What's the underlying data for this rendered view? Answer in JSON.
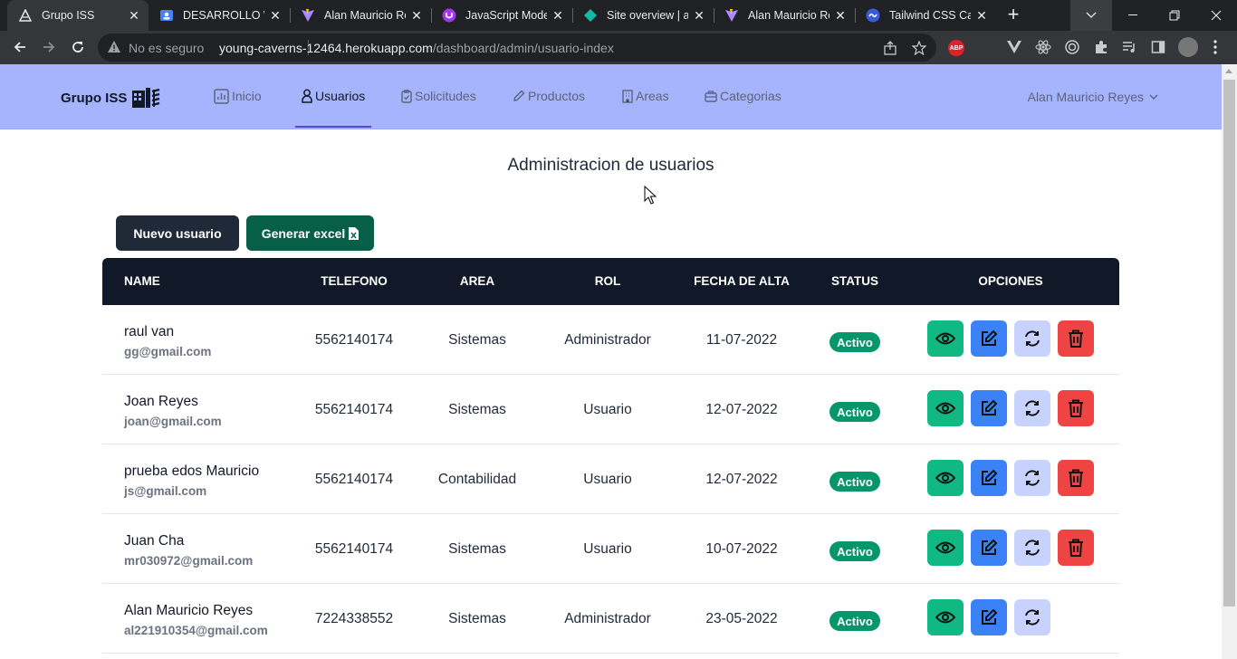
{
  "browser": {
    "tabs": [
      {
        "title": "Grupo ISS",
        "favicon": "triangle-logo-icon",
        "active": true
      },
      {
        "title": "DESARROLLO WE",
        "favicon": "google-sites-icon",
        "active": false
      },
      {
        "title": "Alan Mauricio Re",
        "favicon": "vite-icon",
        "active": false
      },
      {
        "title": "JavaScript Moder",
        "favicon": "udemy-icon",
        "active": false
      },
      {
        "title": "Site overview | al",
        "favicon": "netlify-icon",
        "active": false
      },
      {
        "title": "Alan Mauricio Re",
        "favicon": "vite-icon",
        "active": false
      },
      {
        "title": "Tailwind CSS Card",
        "favicon": "tailwind-icon",
        "active": false
      }
    ],
    "omnibox": {
      "security": "No es seguro",
      "host": "young-caverns-12464.herokuapp.com",
      "path": "/dashboard/admin/usuario-index"
    },
    "extensions": {
      "abp": "ABP"
    }
  },
  "nav": {
    "brand": "Grupo ISS",
    "items": [
      {
        "label": "Inicio",
        "icon": "chart-icon"
      },
      {
        "label": "Usuarios",
        "icon": "user-icon"
      },
      {
        "label": "Solicitudes",
        "icon": "clipboard-icon"
      },
      {
        "label": "Productos",
        "icon": "pencil-icon"
      },
      {
        "label": "Areas",
        "icon": "building-icon"
      },
      {
        "label": "Categorias",
        "icon": "briefcase-icon"
      }
    ],
    "user": "Alan Mauricio Reyes"
  },
  "page": {
    "title": "Administracion de usuarios",
    "new_user_button": "Nuevo usuario",
    "excel_button": "Generar excel"
  },
  "table": {
    "headers": [
      "NAME",
      "TELEFONO",
      "AREA",
      "ROL",
      "FECHA DE ALTA",
      "STATUS",
      "OPCIONES"
    ],
    "rows": [
      {
        "name": "raul van",
        "email": "gg@gmail.com",
        "phone": "5562140174",
        "area": "Sistemas",
        "role": "Administrador",
        "date": "11-07-2022",
        "status": "Activo",
        "deletable": true
      },
      {
        "name": "Joan Reyes",
        "email": "joan@gmail.com",
        "phone": "5562140174",
        "area": "Sistemas",
        "role": "Usuario",
        "date": "12-07-2022",
        "status": "Activo",
        "deletable": true
      },
      {
        "name": "prueba edos Mauricio",
        "email": "js@gmail.com",
        "phone": "5562140174",
        "area": "Contabilidad",
        "role": "Usuario",
        "date": "12-07-2022",
        "status": "Activo",
        "deletable": true
      },
      {
        "name": "Juan Cha",
        "email": "mr030972@gmail.com",
        "phone": "5562140174",
        "area": "Sistemas",
        "role": "Usuario",
        "date": "10-07-2022",
        "status": "Activo",
        "deletable": true
      },
      {
        "name": "Alan Mauricio Reyes",
        "email": "al221910354@gmail.com",
        "phone": "7224338552",
        "area": "Sistemas",
        "role": "Administrador",
        "date": "23-05-2022",
        "status": "Activo",
        "deletable": false
      }
    ]
  },
  "colors": {
    "nav_bg": "#a5b4fc",
    "header_bg": "#111827",
    "status_active": "#059669",
    "view": "#10b981",
    "edit": "#3b82f6",
    "reset": "#c7d2fe",
    "delete": "#ef4444"
  }
}
